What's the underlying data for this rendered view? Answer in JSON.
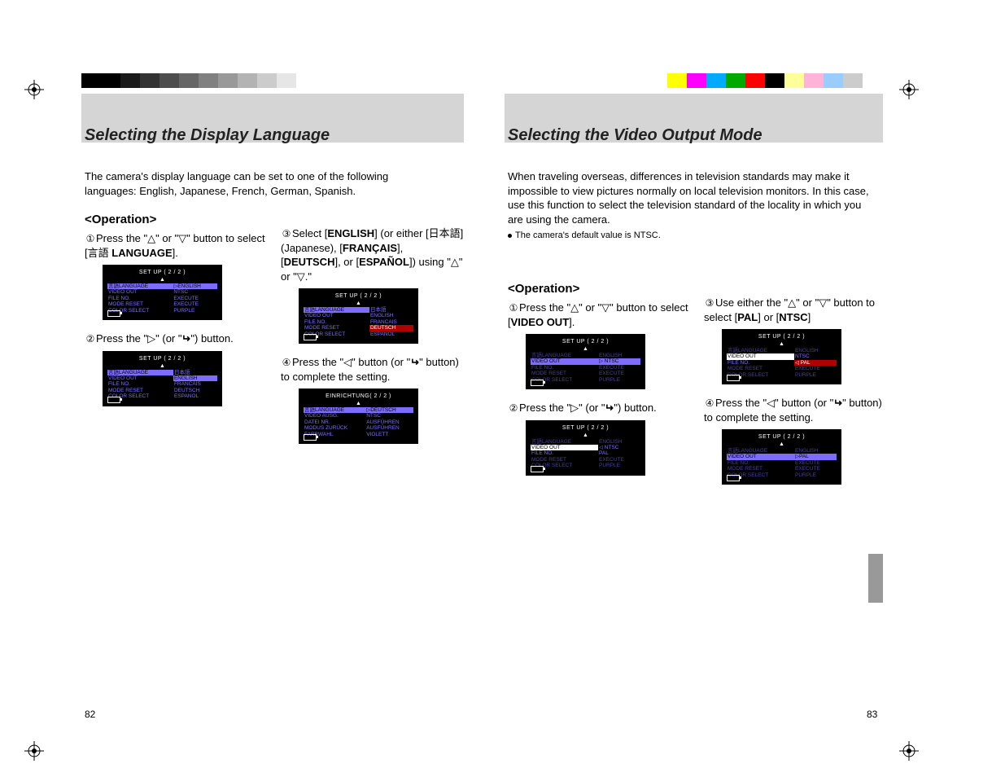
{
  "crop_marks": true,
  "colorbars": {
    "left_grays": [
      "#000000",
      "#000000",
      "#1a1a1a",
      "#333333",
      "#4d4d4d",
      "#666666",
      "#808080",
      "#999999",
      "#b3b3b3",
      "#cccccc",
      "#e6e6e6",
      "#ffffff"
    ],
    "right_colors": [
      "#ffff00",
      "#ff00ff",
      "#00aaff",
      "#00aa00",
      "#ff0000",
      "#000000",
      "#ffff99",
      "#ffb3d9",
      "#99ccff",
      "#cccccc"
    ]
  },
  "left_page": {
    "number": "82",
    "title": "Selecting the Display Language",
    "intro": "The camera's display language can be set to one of the following languages: English, Japanese, French, German, Spanish.",
    "operation_heading": "<Operation>",
    "steps": {
      "s1": {
        "num": "①",
        "text_a": "Press the \"",
        "tri_up": "△",
        "text_b": "\" or \"",
        "tri_down": "▽",
        "text_c": "\" button to select [",
        "jp": "言語",
        "bold": " LANGUAGE",
        "text_d": "]."
      },
      "s2": {
        "num": "②",
        "text_a": "Press the \"",
        "tri_r": "▷",
        "text_b": "\" (or \"",
        "enter": "↵",
        "text_c": "\") button."
      },
      "s3": {
        "num": "③",
        "text_a": "Select [",
        "b1": "ENGLISH",
        "text_b": "] (or either [",
        "jp": "日本語",
        "text_c": "] (Japanese), [",
        "b2": "FRANÇAIS",
        "text_d": "], [",
        "b3": "DEUTSCH",
        "text_e": "], or [",
        "b4": "ESPAÑOL",
        "text_f": "]) using \"",
        "tri_up": "△",
        "text_g": "\" or \"",
        "tri_down": "▽",
        "text_h": ".\""
      },
      "s4": {
        "num": "④",
        "text_a": "Press the \"",
        "tri_l": "◁",
        "text_b": "\" button (or \"",
        "enter": "↵",
        "text_c": "\" button) to complete the setting."
      }
    },
    "lcd1": {
      "title": "SET UP ( 2 / 2 )",
      "rows": [
        {
          "l": "言語LANGUAGE",
          "r": "▷ENGLISH",
          "hi": "row"
        },
        {
          "l": "VIDEO OUT",
          "r": "NTSC"
        },
        {
          "l": "FILE NO.",
          "r": "EXECUTE"
        },
        {
          "l": "MODE RESET",
          "r": "EXECUTE"
        },
        {
          "l": "COLOR SELECT",
          "r": "PURPLE"
        }
      ]
    },
    "lcd2": {
      "title": "SET UP ( 2 / 2 )",
      "rows": [
        {
          "l": "言語LANGUAGE",
          "r": "日本語",
          "hi": "left"
        },
        {
          "l": "VIDEO OUT",
          "r": "ENGLISH",
          "hi": "right"
        },
        {
          "l": "FILE NO.",
          "r": "FRANCAIS"
        },
        {
          "l": "MODE RESET",
          "r": "DEUTSCH"
        },
        {
          "l": "COLOR SELECT",
          "r": "ESPANOL"
        }
      ]
    },
    "lcd3": {
      "title": "SET UP ( 2 / 2 )",
      "rows": [
        {
          "l": "言語LANGUAGE",
          "r": "日本語",
          "hi": "left"
        },
        {
          "l": "VIDEO OUT",
          "r": "ENGLISH"
        },
        {
          "l": "FILE NO.",
          "r": "FRANCAIS"
        },
        {
          "l": "MODE RESET",
          "r": "DEUTSCH",
          "hi": "right-red"
        },
        {
          "l": "COLOR SELECT",
          "r": "ESPANOL"
        }
      ]
    },
    "lcd4": {
      "title": "EINRICHTUNG( 2 / 2 )",
      "rows": [
        {
          "l": "言語LANGUAGE",
          "r": "▷DEUTSCH",
          "hi": "row"
        },
        {
          "l": "VIDEO AUSG.",
          "r": "NTSC"
        },
        {
          "l": "DATEI NR.",
          "r": "AUSFÜHREN"
        },
        {
          "l": "MODUS ZURÜCK",
          "r": "AUSFÜHREN"
        },
        {
          "l": "FARBWAHL",
          "r": "VIOLETT"
        }
      ]
    }
  },
  "right_page": {
    "number": "83",
    "title": "Selecting the Video Output Mode",
    "intro": "When traveling overseas, differences in television standards may make it impossible to view pictures normally on local television monitors. In this case, use this function to select the television standard of the locality in which you are using the camera.",
    "bullet": "The camera's default value is NTSC.",
    "operation_heading": "<Operation>",
    "steps": {
      "s1": {
        "num": "①",
        "text_a": "Press the \"",
        "tri_up": "△",
        "text_b": "\" or \"",
        "tri_down": "▽",
        "text_c": "\" button to select [",
        "bold": "VIDEO OUT",
        "text_d": "]."
      },
      "s2": {
        "num": "②",
        "text_a": "Press the \"",
        "tri_r": "▷",
        "text_b": "\" (or \"",
        "enter": "↵",
        "text_c": "\") button."
      },
      "s3": {
        "num": "③",
        "text_a": "Use either the \"",
        "tri_up": "△",
        "text_b": "\" or \"",
        "tri_down": "▽",
        "text_c": "\" button to select [",
        "b1": "PAL",
        "text_d": "] or [",
        "b2": "NTSC",
        "text_e": "]"
      },
      "s4": {
        "num": "④",
        "text_a": "Press the \"",
        "tri_l": "◁",
        "text_b": "\" button (or \"",
        "enter": "↵",
        "text_c": "\" button) to complete the setting."
      }
    },
    "lcd1": {
      "title": "SET UP    ( 2 / 2 )",
      "rows": [
        {
          "l": "言語LANGUAGE",
          "r": "ENGLISH",
          "dim": true
        },
        {
          "l": "VIDEO OUT",
          "r": "▷ NTSC",
          "hi": "row"
        },
        {
          "l": "FILE NO.",
          "r": "EXECUTE",
          "dim": true
        },
        {
          "l": "MODE RESET",
          "r": "EXECUTE",
          "dim": true
        },
        {
          "l": "COLOR SELECT",
          "r": "PURPLE",
          "dim": true
        }
      ]
    },
    "lcd2": {
      "title": "SET UP    ( 2 / 2 )",
      "rows": [
        {
          "l": "言語LANGUAGE",
          "r": "ENGLISH",
          "dim": true
        },
        {
          "l": "VIDEO OUT",
          "r": "◁ NTSC",
          "hi": "left-white"
        },
        {
          "l": "FILE NO.",
          "r": "PAL"
        },
        {
          "l": "MODE RESET",
          "r": "EXECUTE",
          "dim": true
        },
        {
          "l": "COLOR SELECT",
          "r": "PURPLE",
          "dim": true
        }
      ]
    },
    "lcd3": {
      "title": "SET UP ( 2 / 2 )",
      "rows": [
        {
          "l": "言語LANGUAGE",
          "r": "ENGLISH",
          "dim": true
        },
        {
          "l": "VIDEO OUT",
          "r": "NTSC",
          "hi": "left-white"
        },
        {
          "l": "FILE NO.",
          "r": "◁ PAL",
          "hi": "right-red"
        },
        {
          "l": "MODE RESET",
          "r": "EXECUTE",
          "dim": true
        },
        {
          "l": "COLOR SELECT",
          "r": "PURPLE",
          "dim": true
        }
      ]
    },
    "lcd4": {
      "title": "SET UP    ( 2 / 2 )",
      "rows": [
        {
          "l": "言語LANGUAGE",
          "r": "ENGLISH",
          "dim": true
        },
        {
          "l": "VIDEO OUT",
          "r": "▷PAL",
          "hi": "row"
        },
        {
          "l": "FILE NO.",
          "r": "EXECUTE",
          "dim": true
        },
        {
          "l": "MODE RESET",
          "r": "EXECUTE",
          "dim": true
        },
        {
          "l": "COLOR SELECT",
          "r": "PURPLE",
          "dim": true
        }
      ]
    }
  }
}
